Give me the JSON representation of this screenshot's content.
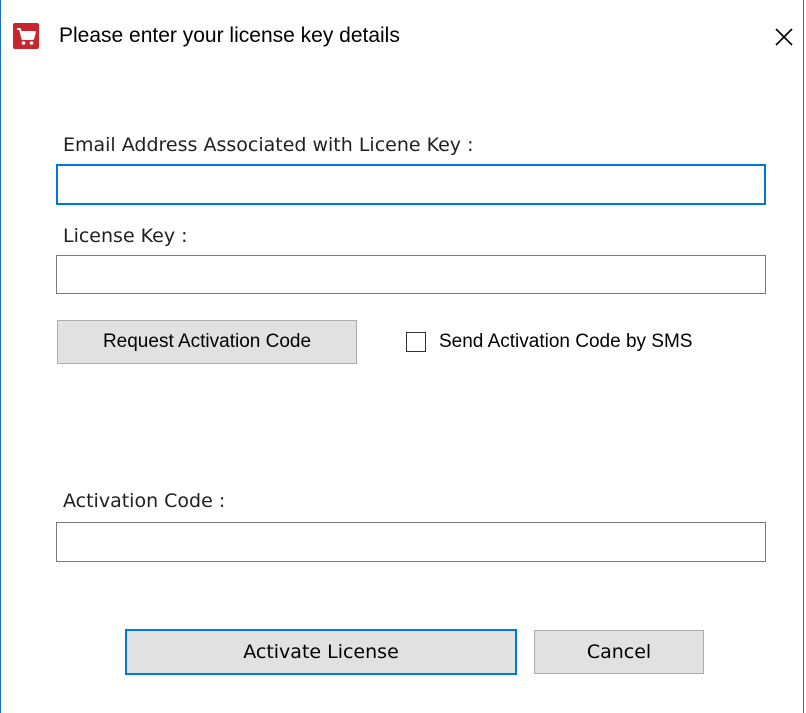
{
  "window": {
    "title": "Please enter your license key details",
    "icon": "shopping-cart-icon",
    "accent_color": "#0078d7"
  },
  "form": {
    "email_label": "Email Address Associated with Licene Key :",
    "email_value": "",
    "license_key_label": "License Key :",
    "license_key_value": "",
    "request_button_label": "Request Activation Code",
    "sms_checkbox_label": "Send Activation Code by SMS",
    "sms_checked": false,
    "activation_code_label": "Activation Code  :",
    "activation_code_value": ""
  },
  "footer": {
    "activate_button_label": "Activate License",
    "cancel_button_label": "Cancel"
  }
}
